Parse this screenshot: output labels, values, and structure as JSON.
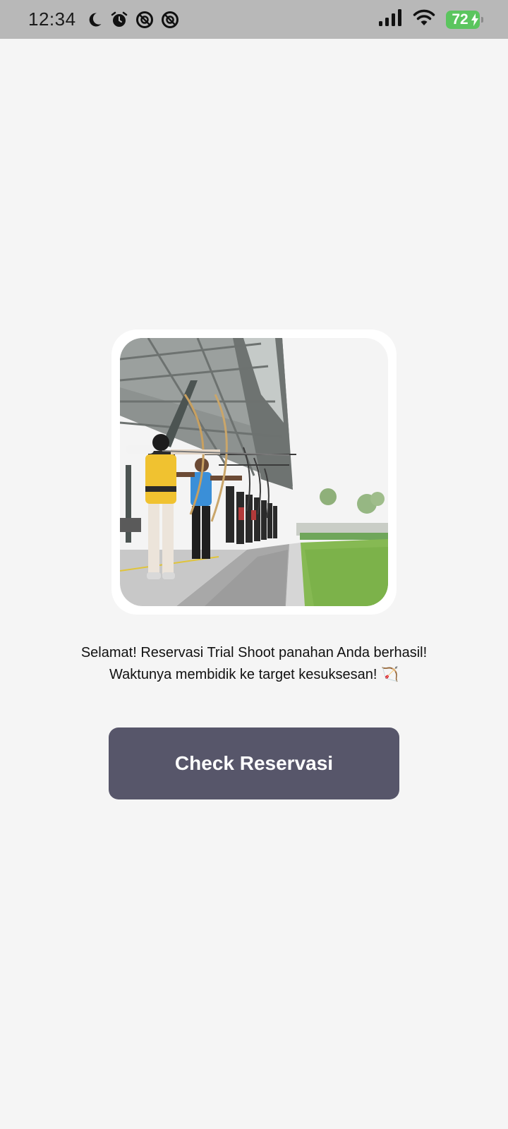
{
  "status_bar": {
    "time": "12:34",
    "left_icons": [
      "moon-icon",
      "alarm-icon",
      "notification-blocked-icon",
      "notification-blocked-icon"
    ],
    "right_icons": [
      "signal-icon",
      "wifi-icon"
    ],
    "battery_level": "72",
    "battery_charging": true,
    "battery_color": "#5bc55e"
  },
  "main": {
    "photo_icon": "archery-range-photo",
    "message_line1": "Selamat! Reservasi Trial Shoot panahan Anda berhasil!",
    "message_line2": "Waktunya membidik ke target kesuksesan! 🏹",
    "button_label": "Check Reservasi",
    "button_color": "#57566a",
    "background_color": "#f5f5f5"
  }
}
